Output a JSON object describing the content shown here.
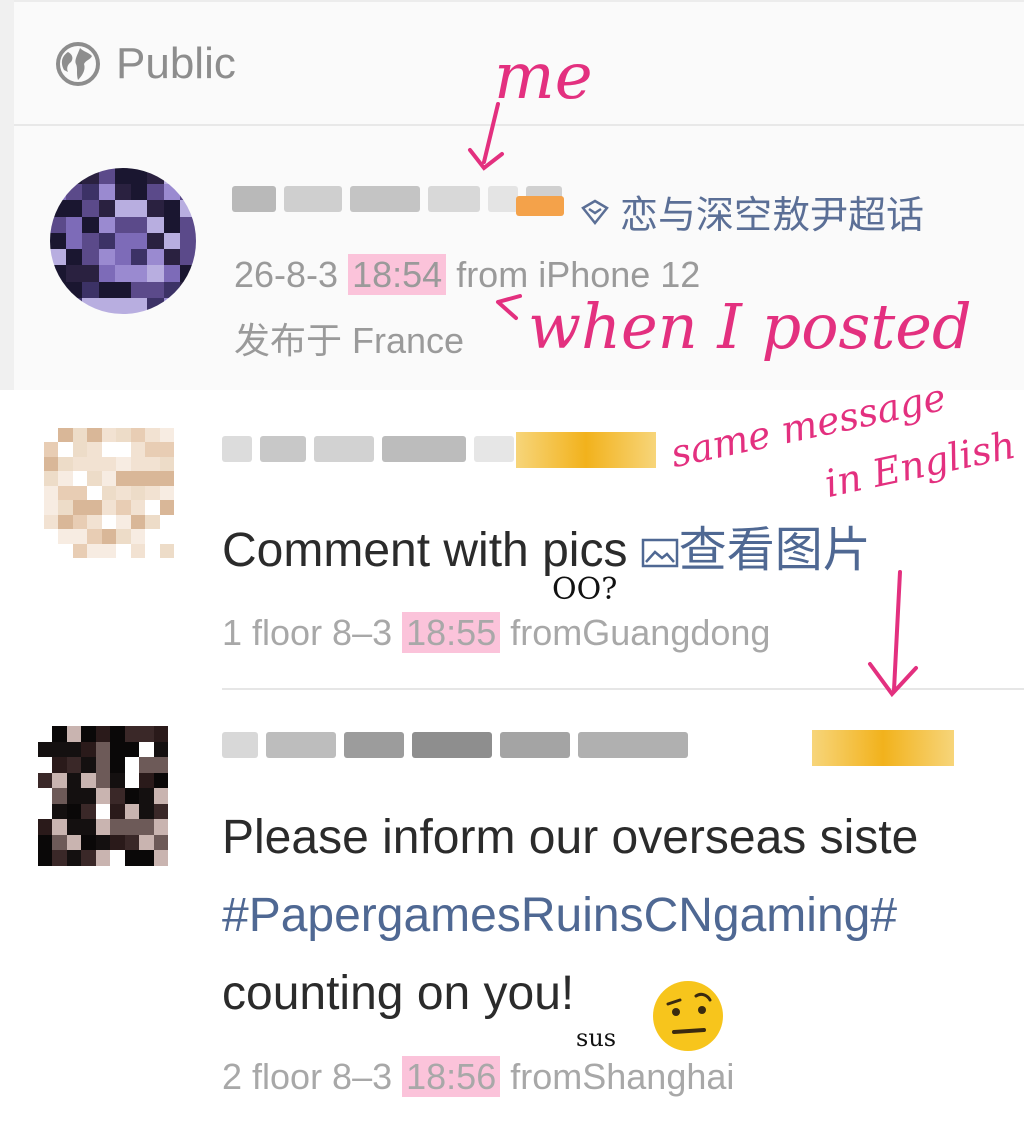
{
  "header": {
    "visibility": "Public"
  },
  "post": {
    "supertopic": "恋与深空敖尹超话",
    "date": "26-8-3",
    "time": "18:54",
    "source": "from iPhone 12",
    "location": "发布于 France"
  },
  "comments": [
    {
      "text": "Comment with pics",
      "link": "查看图片",
      "floor": "1 floor 8–3",
      "time": "18:55",
      "origin": "fromGuangdong"
    },
    {
      "line1": "Please inform our overseas siste",
      "hashtag": "#PapergamesRuinsCNgaming#",
      "line3": "counting on you!",
      "floor": "2 floor 8–3",
      "time": "18:56",
      "origin": "fromShanghai"
    }
  ],
  "annotations": {
    "me": "me",
    "when_posted": "when I posted",
    "same_message": "same message",
    "in_english": "in English",
    "eyes": "OO?",
    "sus": "sus"
  },
  "colors": {
    "highlight": "#fbc3da",
    "annotation": "#e3307f",
    "link": "#4f6893",
    "meta_gray": "#9a9a9a"
  }
}
